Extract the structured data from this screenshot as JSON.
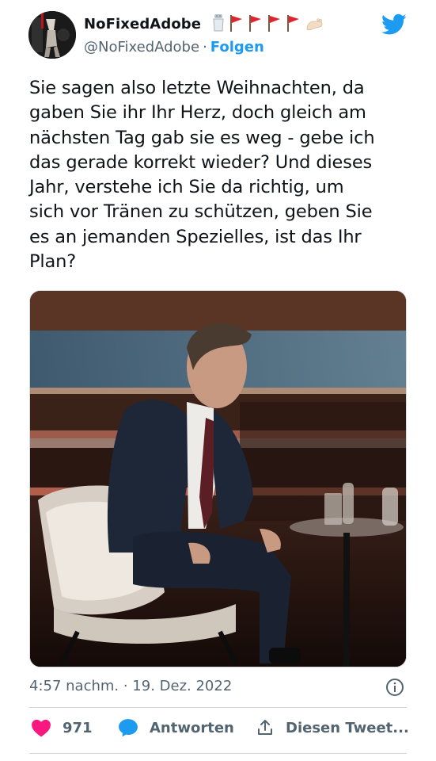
{
  "tweet": {
    "author": {
      "display_name": "NoFixedAdobe",
      "handle": "@NoFixedAdobe",
      "separator": "·",
      "follow_label": "Folgen",
      "name_emojis": [
        "salt-shaker-icon",
        "red-flag-icon",
        "red-flag-icon",
        "red-flag-icon",
        "red-flag-icon",
        "foot-icon"
      ]
    },
    "text_lines": [
      "Sie sagen also letzte Weihnachten, da",
      "gaben Sie ihr Ihr Herz, doch gleich am",
      "nächsten Tag gab sie es weg - gebe ich",
      "das gerade korrekt wieder? Und dieses",
      "Jahr, verstehe ich Sie da richtig, um",
      "sich vor Tränen zu schützen, geben Sie",
      "es an jemanden Spezielles, ist das Ihr",
      "Plan?"
    ],
    "timestamp": "4:57 nachm. · 19. Dez. 2022",
    "likes": "971",
    "reply_label": "Antworten",
    "share_label": "Diesen Tweet..."
  },
  "colors": {
    "accent": "#1d9bf0",
    "like": "#f91880",
    "secondary_text": "#536471",
    "primary_text": "#0f1419",
    "divider": "#cfd9de"
  }
}
